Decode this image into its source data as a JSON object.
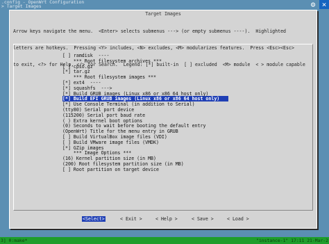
{
  "topbar": {
    "line1": ".config - OpenWrt Configuration",
    "line2": "> Target Images"
  },
  "window_icons": [
    "gear-icon",
    "close-icon"
  ],
  "dialog": {
    "title": "Target Images",
    "help": [
      "Arrow keys navigate the menu.  <Enter> selects submenus ---> (or empty submenus ----).  Highlighted",
      "letters are hotkeys.  Pressing <Y> includes, <N> excludes, <M> modularizes features.  Press <Esc><Esc>",
      "to exit, <?> for Help, </> for Search.  Legend: [*] built-in  [ ] excluded  <M> module  < > module capable"
    ],
    "items": [
      "[ ] ramdisk  ----",
      "    *** Root filesystem archives ***",
      "[ ] cpio.gz",
      "[*] tar.gz",
      "    *** Root filesystem images ***",
      "[*] ext4  ----",
      "[*] squashfs  --->",
      "[*] Build GRUB images (Linux x86 or x86 64 host only)",
      "[*] Build EFI GRUB images (Linux x86 or x86 64 host only)",
      "[*] Use Console Terminal (in addition to Serial)",
      "(tty80) Serial port device",
      "(115200) Serial port baud rate",
      "( ) Extra kernel boot options",
      "(0) Seconds to wait before booting the default entry",
      "(OpenWrt) Title for the menu entry in GRUB",
      "[ ] Build VirtualBox image files (VDI)",
      "[ ] Build VMware image files (VMDK)",
      "[*] GZip images",
      "    *** Image Options ***",
      "(16) Kernel partition size (in MB)",
      "(200) Root filesystem partition size (in MB)",
      "[ ] Root partition on target device"
    ],
    "selected_index": 8,
    "buttons": [
      "<Select>",
      "< Exit >",
      "< Help >",
      "< Save >",
      "< Load >"
    ]
  },
  "statusbar": {
    "left": "3] 0:make*",
    "right": "\"instance-1\" 17:11 21-Mar-2"
  },
  "colors": {
    "background": "#5b8fb3",
    "dialog": "#d4d4d4",
    "highlight": "#1f3fb5",
    "statusbar": "#1f9e2c"
  }
}
